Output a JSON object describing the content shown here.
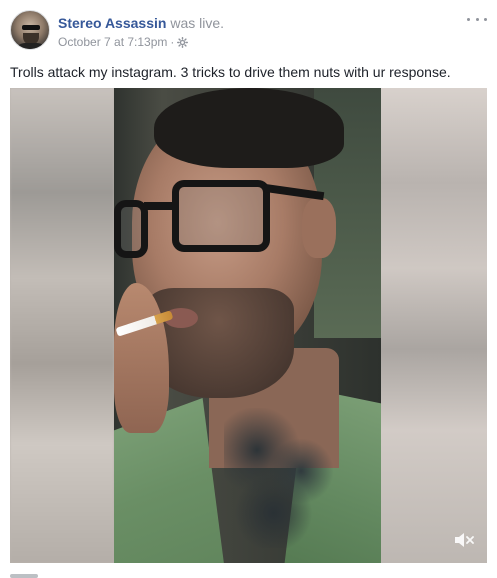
{
  "post": {
    "author": "Stereo Assassin",
    "status": "was live.",
    "timestamp": "October 7 at 7:13pm",
    "separator": "·",
    "privacy_icon": "gear-icon",
    "more_icon": "more-options-icon",
    "message": "Trolls attack my instagram. 3 tricks to drive them nuts with ur response."
  },
  "video": {
    "mute_icon": "mute-speaker-icon"
  },
  "colors": {
    "author_link": "#365899",
    "meta_text": "#90949c",
    "body_text": "#1d2129"
  }
}
